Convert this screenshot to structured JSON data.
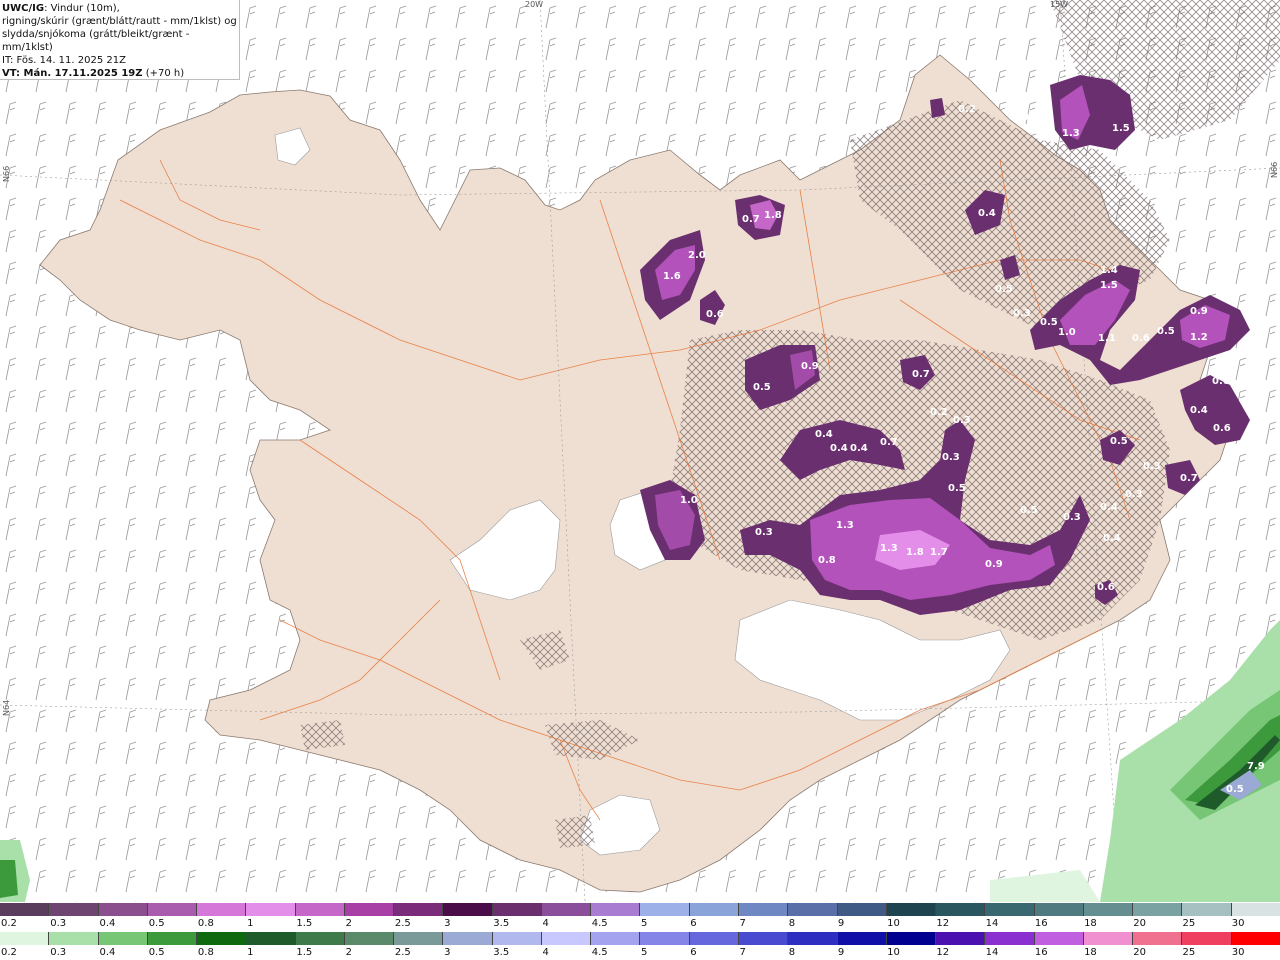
{
  "header": {
    "model": "UWC/IG",
    "line1_rest": ": Vindur (10m),",
    "line2": "rigning/skúrir (grænt/blátt/rautt - mm/1klst) og",
    "line3": "slydda/snjókoma (grátt/bleikt/grænt - mm/1klst)",
    "line4": "IT: Fös. 14. 11. 2025 21Z",
    "line5_bold": "VT: Mán. 17.11.2025 19Z",
    "line5_rest": " (+70 h)"
  },
  "grid_labels": {
    "lon_20w": "20W",
    "lon_15w": "15W",
    "lat_66n_left": "N66",
    "lat_66n_right": "N66",
    "lat_64n": "N64"
  },
  "precip_labels": [
    "0.2",
    "0.3",
    "0.4",
    "0.5",
    "0.8",
    "1",
    "1.5",
    "2",
    "2.5",
    "3",
    "3.5",
    "4",
    "4.5",
    "5",
    "6",
    "7",
    "8",
    "9",
    "10",
    "12",
    "14",
    "16",
    "18",
    "20",
    "25",
    "30"
  ],
  "snow_legend_colors": [
    "#5a3d5c",
    "#6e4570",
    "#8a4f8c",
    "#a95cae",
    "#d477d8",
    "#e38ee8",
    "#c566c9",
    "#a83fa6",
    "#7a2b7a",
    "#4a0d4a",
    "#6b2f6e",
    "#8b4e9a",
    "#a87cd0",
    "#9db0e8",
    "#8aa3d9",
    "#6f87c2",
    "#5a6fa8",
    "#3f5a85",
    "#1f4450",
    "#2a5660",
    "#3a6870",
    "#4e7a80",
    "#648e90",
    "#7ba2a2",
    "#a6bfc0",
    "#d9e2e2"
  ],
  "rain_legend_colors": [
    "#dff5df",
    "#a9e0a9",
    "#76c676",
    "#3c9a3c",
    "#0f6a0f",
    "#1f5a2a",
    "#3f7a4a",
    "#5a8a6a",
    "#7a9a9a",
    "#9aaad4",
    "#b0b8ee",
    "#c8c8ff",
    "#a3a3f0",
    "#8585e8",
    "#6666dd",
    "#4a4ad0",
    "#2e2ec0",
    "#1010a8",
    "#000090",
    "#4a10b0",
    "#8a30d0",
    "#c060e0",
    "#f090d0",
    "#f07090",
    "#f04060",
    "#ff0000"
  ],
  "precip_values": [
    "0.2",
    "0.3",
    "0.4",
    "0.5",
    "0.6",
    "0.7",
    "0.8",
    "0.9",
    "1.0",
    "1.1",
    "1.3",
    "1.4",
    "1.5",
    "1.6",
    "1.7",
    "1.8",
    "2.0",
    "7.9"
  ]
}
